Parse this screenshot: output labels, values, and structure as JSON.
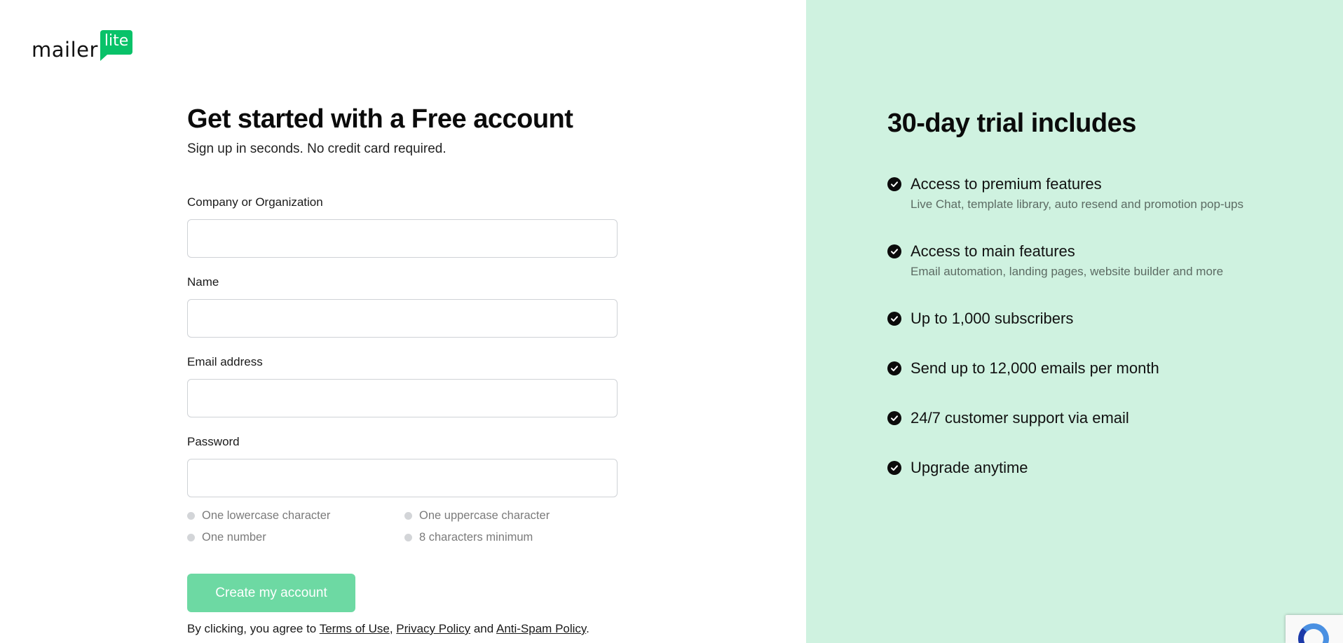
{
  "logo": {
    "word": "mailer",
    "badge": "lite",
    "brand_color": "#09c269"
  },
  "form": {
    "heading": "Get started with a Free account",
    "subheading": "Sign up in seconds. No credit card required.",
    "fields": {
      "company": {
        "label": "Company or Organization",
        "value": "",
        "placeholder": ""
      },
      "name": {
        "label": "Name",
        "value": "",
        "placeholder": ""
      },
      "email": {
        "label": "Email address",
        "value": "",
        "placeholder": ""
      },
      "password": {
        "label": "Password",
        "value": "",
        "placeholder": ""
      }
    },
    "password_rules": [
      "One lowercase character",
      "One uppercase character",
      "One number",
      "8 characters minimum"
    ],
    "submit_label": "Create my account",
    "submit_color": "#6dd9a3",
    "legal": {
      "prefix": "By clicking, you agree to ",
      "terms": "Terms of Use",
      "comma": ",",
      "privacy": "Privacy Policy",
      "and": " and ",
      "antispam": "Anti-Spam Policy",
      "period": "."
    }
  },
  "trial": {
    "title": "30-day trial includes",
    "panel_color": "#cff2e0",
    "features": [
      {
        "title": "Access to premium features",
        "desc": "Live Chat, template library, auto resend and promotion pop-ups"
      },
      {
        "title": "Access to main features",
        "desc": "Email automation, landing pages, website builder and more"
      },
      {
        "title": "Up to 1,000 subscribers",
        "desc": ""
      },
      {
        "title": "Send up to 12,000 emails per month",
        "desc": ""
      },
      {
        "title": "24/7 customer support via email",
        "desc": ""
      },
      {
        "title": "Upgrade anytime",
        "desc": ""
      }
    ],
    "icon": "check-circle-icon"
  },
  "recaptcha_icon": "recaptcha-icon"
}
